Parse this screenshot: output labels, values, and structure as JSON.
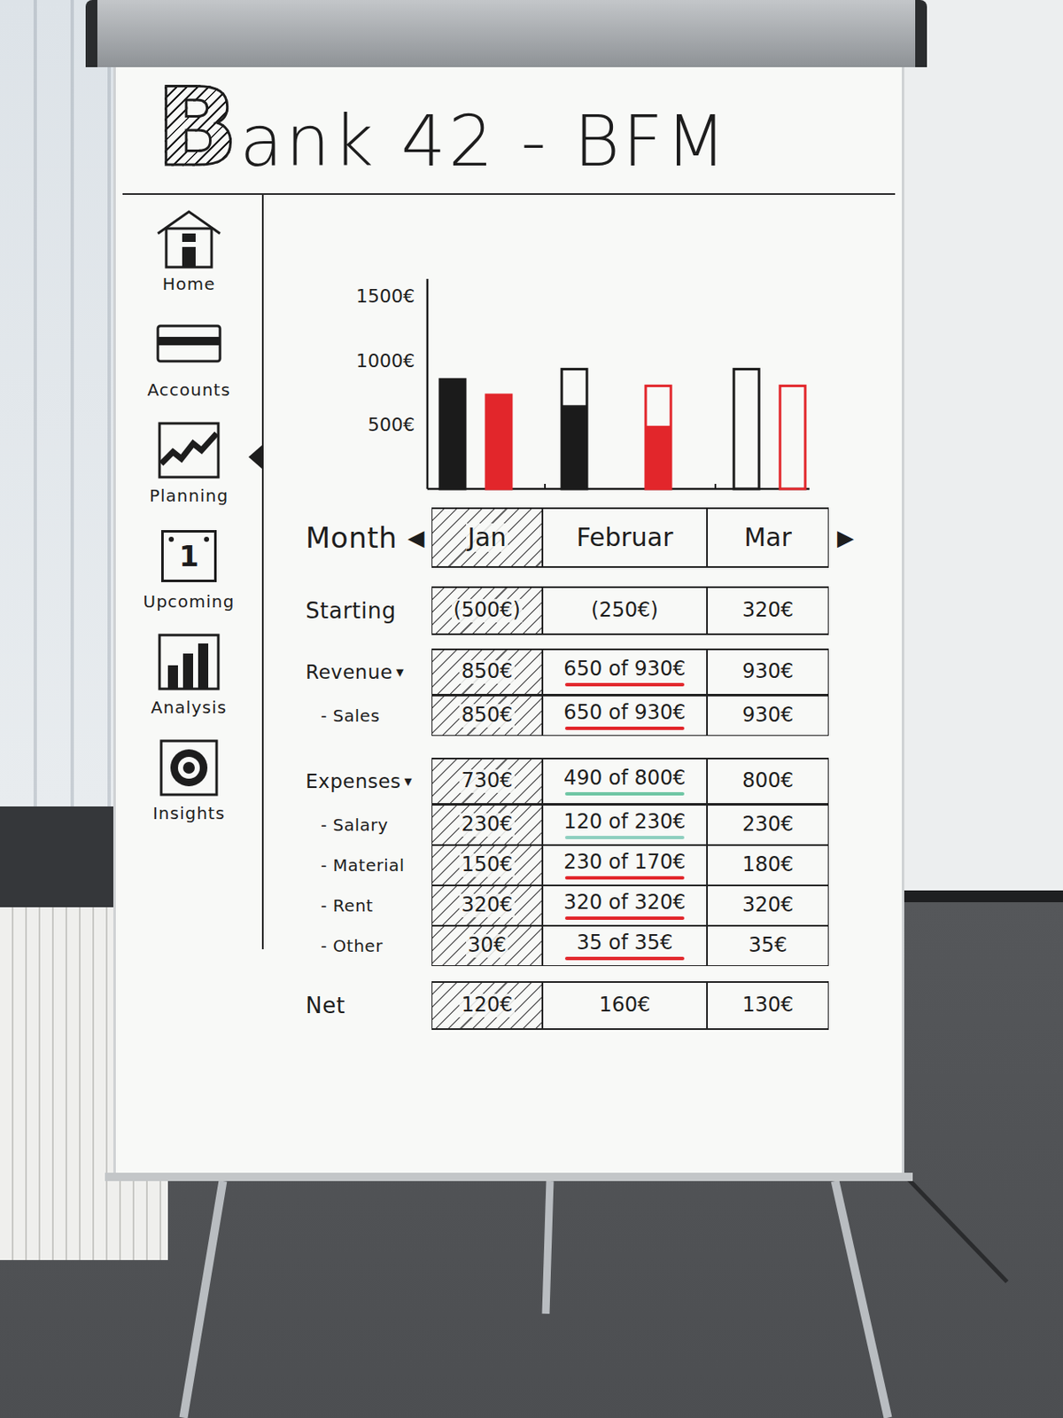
{
  "board": {
    "title": {
      "logo_letter": "B",
      "text": "ank 42 - BFM"
    }
  },
  "sidebar": {
    "items": [
      {
        "label": "Home",
        "selected": false
      },
      {
        "label": "Accounts",
        "selected": false
      },
      {
        "label": "Planning",
        "selected": true
      },
      {
        "label": "Upcoming",
        "selected": false,
        "icon_text": "1"
      },
      {
        "label": "Analysis",
        "selected": false
      },
      {
        "label": "Insights",
        "selected": false
      }
    ]
  },
  "chart": {
    "ticks": [
      "1500€",
      "1000€",
      "500€"
    ],
    "series": [
      {
        "name": "Revenue",
        "color": "#1b1b1b",
        "planned": [
          850,
          930,
          930
        ],
        "actual": [
          850,
          650,
          0
        ]
      },
      {
        "name": "Expenses",
        "color": "#e2262b",
        "planned": [
          730,
          800,
          800
        ],
        "actual": [
          730,
          490,
          0
        ]
      }
    ]
  },
  "table": {
    "month_row": {
      "label": "Month",
      "prev": "◀",
      "next": "▶",
      "months": [
        {
          "text": "Jan",
          "selected": true
        },
        {
          "text": "Februar",
          "selected": false
        },
        {
          "text": "Mar",
          "selected": false
        }
      ]
    },
    "groups": [
      {
        "rows": [
          {
            "kind": "total",
            "label": "Starting",
            "cells": [
              {
                "text": "(500€)"
              },
              {
                "text": "(250€)"
              },
              {
                "text": "320€"
              }
            ]
          }
        ]
      },
      {
        "rows": [
          {
            "kind": "group",
            "label": "Revenue",
            "toggle": "▾",
            "cells": [
              {
                "text": "850€"
              },
              {
                "text": "650 of 930€",
                "underline": "#e2262b"
              },
              {
                "text": "930€"
              }
            ]
          },
          {
            "kind": "item",
            "label": "- Sales",
            "cells": [
              {
                "text": "850€"
              },
              {
                "text": "650 of 930€",
                "underline": "#e2262b"
              },
              {
                "text": "930€"
              }
            ]
          }
        ]
      },
      {
        "rows": [
          {
            "kind": "group",
            "label": "Expenses",
            "toggle": "▾",
            "cells": [
              {
                "text": "730€"
              },
              {
                "text": "490 of 800€",
                "underline": "#6fc6a4"
              },
              {
                "text": "800€"
              }
            ]
          },
          {
            "kind": "item",
            "label": "- Salary",
            "cells": [
              {
                "text": "230€"
              },
              {
                "text": "120 of 230€",
                "underline": "#8fd0c0"
              },
              {
                "text": "230€"
              }
            ]
          },
          {
            "kind": "item",
            "label": "- Material",
            "cells": [
              {
                "text": "150€"
              },
              {
                "text": "230 of 170€",
                "underline": "#e2262b"
              },
              {
                "text": "180€"
              }
            ]
          },
          {
            "kind": "item",
            "label": "- Rent",
            "cells": [
              {
                "text": "320€"
              },
              {
                "text": "320 of 320€",
                "underline": "#e2262b"
              },
              {
                "text": "320€"
              }
            ]
          },
          {
            "kind": "item",
            "label": "- Other",
            "cells": [
              {
                "text": "30€"
              },
              {
                "text": "35 of 35€",
                "underline": "#e2262b"
              },
              {
                "text": "35€"
              }
            ]
          }
        ]
      },
      {
        "rows": [
          {
            "kind": "total",
            "label": "Net",
            "cells": [
              {
                "text": "120€"
              },
              {
                "text": "160€"
              },
              {
                "text": "130€"
              }
            ]
          }
        ]
      }
    ]
  }
}
